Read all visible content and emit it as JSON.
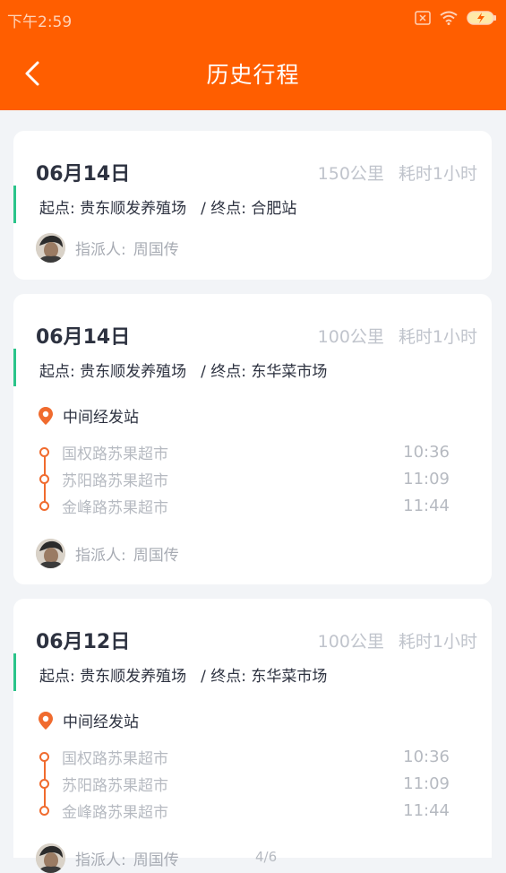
{
  "status_bar": {
    "time": "下午2:59"
  },
  "header": {
    "title": "历史行程"
  },
  "trips": [
    {
      "date": "06月14日",
      "distance": "150公里",
      "duration": "耗时1小时",
      "start": "起点: 贵东顺发养殖场",
      "end": "/ 终点: 合肥站",
      "assignee_label": "指派人:",
      "assignee_name": "周国传"
    },
    {
      "date": "06月14日",
      "distance": "100公里",
      "duration": "耗时1小时",
      "start": "起点: 贵东顺发养殖场",
      "end": "/ 终点: 东华菜市场",
      "waypoints_title": "中间经发站",
      "stops": [
        {
          "name": "国权路苏果超市",
          "time": "10:36"
        },
        {
          "name": "苏阳路苏果超市",
          "time": "11:09"
        },
        {
          "name": "金峰路苏果超市",
          "time": "11:44"
        }
      ],
      "assignee_label": "指派人:",
      "assignee_name": "周国传"
    },
    {
      "date": "06月12日",
      "distance": "100公里",
      "duration": "耗时1小时",
      "start": "起点: 贵东顺发养殖场",
      "end": "/ 终点: 东华菜市场",
      "waypoints_title": "中间经发站",
      "stops": [
        {
          "name": "国权路苏果超市",
          "time": "10:36"
        },
        {
          "name": "苏阳路苏果超市",
          "time": "11:09"
        },
        {
          "name": "金峰路苏果超市",
          "time": "11:44"
        }
      ],
      "assignee_label": "指派人:",
      "assignee_name": "周国传"
    }
  ],
  "pager": {
    "text": "4/6"
  },
  "colors": {
    "header": "#ff5e00",
    "route_accent": "#2bc48a",
    "waypoint": "#f06b2e"
  },
  "icons": {
    "back": "chevron-left-icon",
    "waypoint": "location-pin-icon"
  }
}
